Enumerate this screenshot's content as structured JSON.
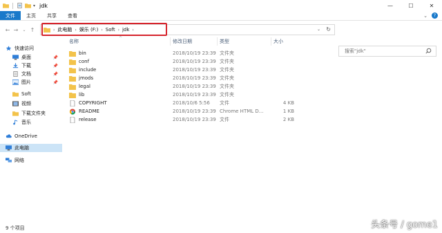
{
  "window": {
    "title": "jdk",
    "minimize_icon": "minimize-icon",
    "maximize_icon": "maximize-icon",
    "close_icon": "close-icon"
  },
  "ribbon": {
    "tabs": [
      {
        "label": "文件"
      },
      {
        "label": "主页"
      },
      {
        "label": "共享"
      },
      {
        "label": "查看"
      }
    ]
  },
  "navigation": {
    "breadcrumbs": [
      "此电脑",
      "娱乐 (F:)",
      "Soft",
      "jdk"
    ],
    "search_placeholder": "搜索\"jdk\""
  },
  "sidebar": {
    "items": [
      {
        "label": "快速访问",
        "icon": "star-icon",
        "pinned": false
      },
      {
        "label": "桌面",
        "icon": "desktop-icon",
        "pinned": true
      },
      {
        "label": "下载",
        "icon": "download-icon",
        "pinned": true
      },
      {
        "label": "文档",
        "icon": "document-icon",
        "pinned": true
      },
      {
        "label": "图片",
        "icon": "picture-icon",
        "pinned": true
      },
      {
        "label": "Soft",
        "icon": "folder-icon",
        "pinned": false
      },
      {
        "label": "视频",
        "icon": "video-icon",
        "pinned": false
      },
      {
        "label": "下载文件夹",
        "icon": "folder-icon",
        "pinned": false
      },
      {
        "label": "音乐",
        "icon": "music-icon",
        "pinned": false
      },
      {
        "label": "OneDrive",
        "icon": "cloud-icon",
        "pinned": false
      },
      {
        "label": "此电脑",
        "icon": "computer-icon",
        "pinned": false
      },
      {
        "label": "网络",
        "icon": "network-icon",
        "pinned": false
      }
    ]
  },
  "columns": {
    "name": "名称",
    "modified": "修改日期",
    "type": "类型",
    "size": "大小"
  },
  "files": [
    {
      "name": "bin",
      "modified": "2018/10/19 23:39",
      "type": "文件夹",
      "size": "",
      "icon": "folder-icon"
    },
    {
      "name": "conf",
      "modified": "2018/10/19 23:39",
      "type": "文件夹",
      "size": "",
      "icon": "folder-icon"
    },
    {
      "name": "include",
      "modified": "2018/10/19 23:39",
      "type": "文件夹",
      "size": "",
      "icon": "folder-icon"
    },
    {
      "name": "jmods",
      "modified": "2018/10/19 23:39",
      "type": "文件夹",
      "size": "",
      "icon": "folder-icon"
    },
    {
      "name": "legal",
      "modified": "2018/10/19 23:39",
      "type": "文件夹",
      "size": "",
      "icon": "folder-icon"
    },
    {
      "name": "lib",
      "modified": "2018/10/19 23:39",
      "type": "文件夹",
      "size": "",
      "icon": "folder-icon"
    },
    {
      "name": "COPYRIGHT",
      "modified": "2018/10/6 5:56",
      "type": "文件",
      "size": "4 KB",
      "icon": "file-icon"
    },
    {
      "name": "README",
      "modified": "2018/10/19 23:39",
      "type": "Chrome HTML D...",
      "size": "1 KB",
      "icon": "chrome-icon"
    },
    {
      "name": "release",
      "modified": "2018/10/19 23:39",
      "type": "文件",
      "size": "2 KB",
      "icon": "file-icon"
    }
  ],
  "status": {
    "item_count": "9 个项目",
    "watermark": "头条号 / gome1"
  },
  "colors": {
    "accent": "#1979ca",
    "highlight_box": "#d6232b",
    "selected_bg": "#cce4f7",
    "folder": "#f3c34b"
  }
}
